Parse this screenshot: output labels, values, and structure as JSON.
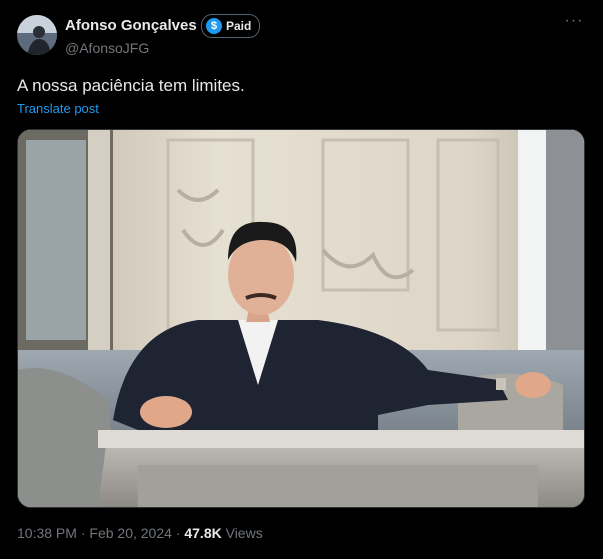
{
  "author": {
    "name": "Afonso Gonçalves",
    "handle": "@AfonsoJFG",
    "badge": "Paid",
    "badge_icon": "$"
  },
  "post": {
    "text": "A nossa paciência tem limites.",
    "translate_label": "Translate post",
    "more_icon": "···"
  },
  "meta": {
    "time": "10:38 PM",
    "separator1": "·",
    "date": "Feb 20, 2024",
    "separator2": "·",
    "views_count": "47.8K",
    "views_label": "Views"
  },
  "colors": {
    "background": "#000000",
    "text": "#e7e9ea",
    "secondary": "#71767b",
    "link": "#1d9bf0"
  }
}
